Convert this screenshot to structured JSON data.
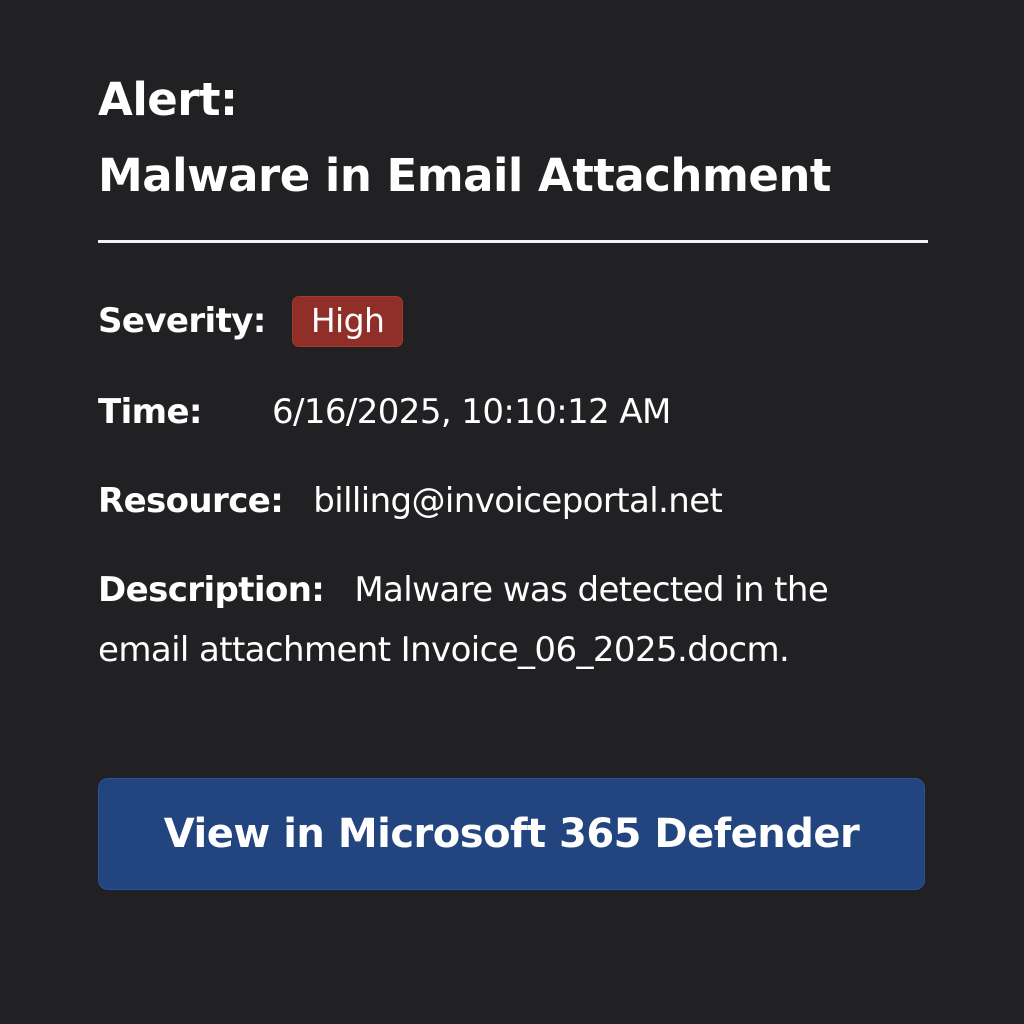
{
  "alert": {
    "title_line1": "Alert:",
    "title_line2": "Malware in Email Attachment",
    "severity_label": "Severity:",
    "severity_value": "High",
    "severity_color": "#8f2f27",
    "time_label": "Time:",
    "time_value": "6/16/2025, 10:10:12 AM",
    "resource_label": "Resource:",
    "resource_value": "billing@invoiceportal.net",
    "description_label": "Description:",
    "description_value": "Malware was detected in the email attachment Invoice_06_2025.docm."
  },
  "action": {
    "button_label": "View in Microsoft 365 Defender",
    "button_color": "#22457f"
  }
}
